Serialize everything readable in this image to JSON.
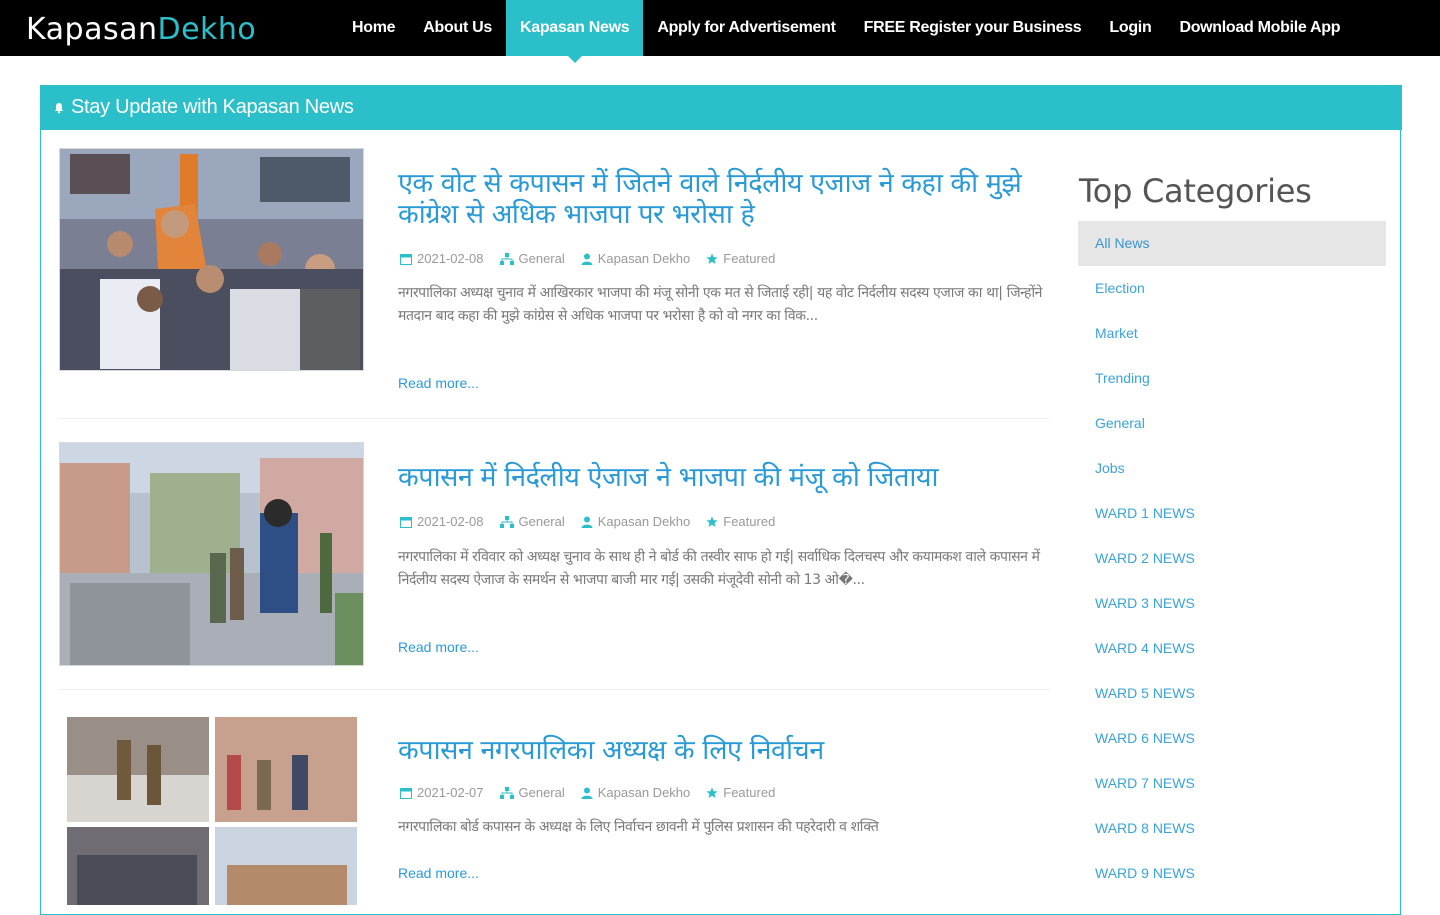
{
  "logo": {
    "part1": "Kapasan",
    "part2": "Dekho"
  },
  "nav": [
    {
      "label": "Home",
      "active": false
    },
    {
      "label": "About Us",
      "active": false
    },
    {
      "label": "Kapasan News",
      "active": true
    },
    {
      "label": "Apply for Advertisement",
      "active": false
    },
    {
      "label": "FREE Register your Business",
      "active": false
    },
    {
      "label": "Login",
      "active": false
    },
    {
      "label": "Download Mobile App",
      "active": false
    }
  ],
  "banner": {
    "text": "Stay Update with Kapasan News"
  },
  "articles": [
    {
      "title": "एक वोट से कपासन में जितने वाले निर्दलीय एजाज ने कहा की मुझे कांग्रेश से अधिक भाजपा पर भरोसा हे",
      "date": "2021-02-08",
      "category": "General",
      "author": "Kapasan Dekho",
      "tag": "Featured",
      "excerpt": "नगरपालिका अध्यक्ष चुनाव में आखिरकार भाजपा की मंजू सोनी एक मत से जिताई रही| यह वोट निर्दलीय सदस्य एजाज का था| जिन्होंने मतदान बाद कहा की मुझे कांग्रेस से अधिक भाजपा पर भरोसा है को वो नगर का विक...",
      "read_more": "Read more..."
    },
    {
      "title": "कपासन में निर्दलीय ऐजाज ने भाजपा की मंजू को जिताया",
      "date": "2021-02-08",
      "category": "General",
      "author": "Kapasan Dekho",
      "tag": "Featured",
      "excerpt": "नगरपालिका में रविवार को अध्यक्ष चुनाव के साथ ही ने बोर्ड की तस्वीर साफ हो गई| सर्वाधिक दिलचस्प और कयामकश वाले कपासन में निर्दलीय सदस्य ऐजाज के समर्थन से भाजपा बाजी मार गई| उसकी मंजूदेवी सोनी को 13 ओ�...",
      "read_more": "Read more..."
    },
    {
      "title": "कपासन नगरपालिका अध्यक्ष के लिए निर्वाचन",
      "date": "2021-02-07",
      "category": "General",
      "author": "Kapasan Dekho",
      "tag": "Featured",
      "excerpt": "नगरपालिका बोर्ड कपासन के अध्यक्ष के लिए निर्वाचन छावनी में पुलिस प्रशासन की पहरेदारी व शक्ति",
      "read_more": "Read more..."
    }
  ],
  "sidebar": {
    "title": "Top Categories",
    "categories": [
      "All News",
      "Election",
      "Market",
      "Trending",
      "General",
      "Jobs",
      "WARD 1 NEWS",
      "WARD 2 NEWS",
      "WARD 3 NEWS",
      "WARD 4 NEWS",
      "WARD 5 NEWS",
      "WARD 6 NEWS",
      "WARD 7 NEWS",
      "WARD 8 NEWS",
      "WARD 9 NEWS"
    ],
    "active_index": 0
  },
  "colors": {
    "accent": "#2bbfca",
    "link": "#2a9ad6",
    "nav_bg": "#000000"
  }
}
